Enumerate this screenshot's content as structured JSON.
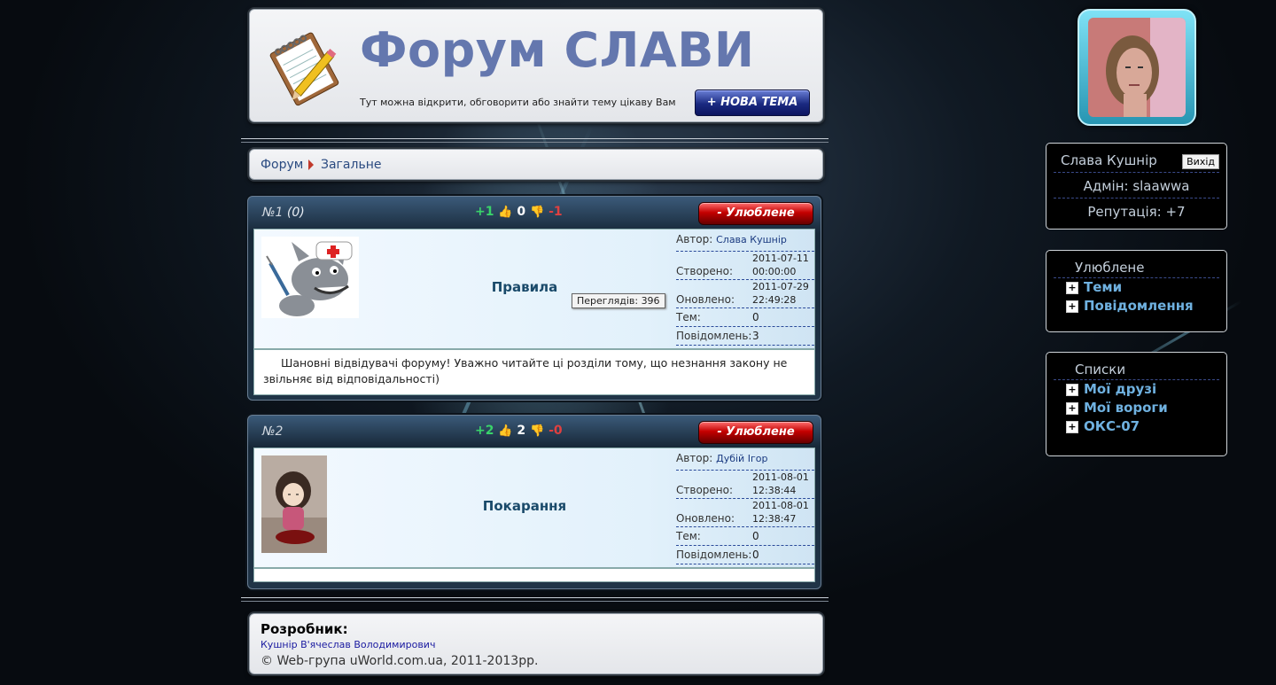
{
  "header": {
    "title": "Форум СЛАВИ",
    "tagline": "Тут можна відкрити, обговорити або знайти тему цікаву Вам",
    "new_topic_button": "+ НОВА ТЕМА"
  },
  "breadcrumb": {
    "root": "Форум",
    "current": "Загальне"
  },
  "topics": [
    {
      "number": "№1",
      "views_badge": "(0)",
      "plus": "+1",
      "rating": "0",
      "minus": "-1",
      "favorite_button": "- Улюблене",
      "name": "Правила",
      "tooltip": "Переглядів: 396",
      "author_label": "Автор:",
      "author": "Слава Кушнір",
      "created_label": "Створено:",
      "created_date": "2011-07-11",
      "created_time": "00:00:00",
      "updated_label": "Оновлено:",
      "updated_date": "2011-07-29",
      "updated_time": "22:49:28",
      "themes_label": "Тем:",
      "themes": "0",
      "posts_label": "Повідомлень:",
      "posts": "3",
      "description": "Шановні відвідувачі форуму! Уважно читайте ці розділи тому, що незнання закону не звільняє від відповідальності)"
    },
    {
      "number": "№2",
      "views_badge": "",
      "plus": "+2",
      "rating": "2",
      "minus": "-0",
      "favorite_button": "- Улюблене",
      "name": "Покарання",
      "author_label": "Автор:",
      "author": "Дубій Ігор",
      "created_label": "Створено:",
      "created_date": "2011-08-01",
      "created_time": "12:38:44",
      "updated_label": "Оновлено:",
      "updated_date": "2011-08-01",
      "updated_time": "12:38:47",
      "themes_label": "Тем:",
      "themes": "0",
      "posts_label": "Повідомлень:",
      "posts": "0",
      "description": ""
    }
  ],
  "footer": {
    "title": "Розробник:",
    "developer": "Кушнір В'ячеслав Володимирович",
    "copyright": "© Web-група uWorld.com.ua, 2011-2013рр."
  },
  "user": {
    "name": "Слава Кушнір",
    "logout": "Вихід",
    "role": "Адмін: slaawwa",
    "reputation": "Репутація: +7"
  },
  "favorites": {
    "title": "Улюблене",
    "items": [
      "Теми",
      "Повідомлення"
    ]
  },
  "lists": {
    "title": "Списки",
    "items": [
      "Мої друзі",
      "Мої вороги",
      "ОКС-07"
    ]
  },
  "colors": {
    "title": "#6477ae",
    "link": "#6fb1e0",
    "favorite_red": "#c40000",
    "new_topic_blue": "#1a2980"
  }
}
